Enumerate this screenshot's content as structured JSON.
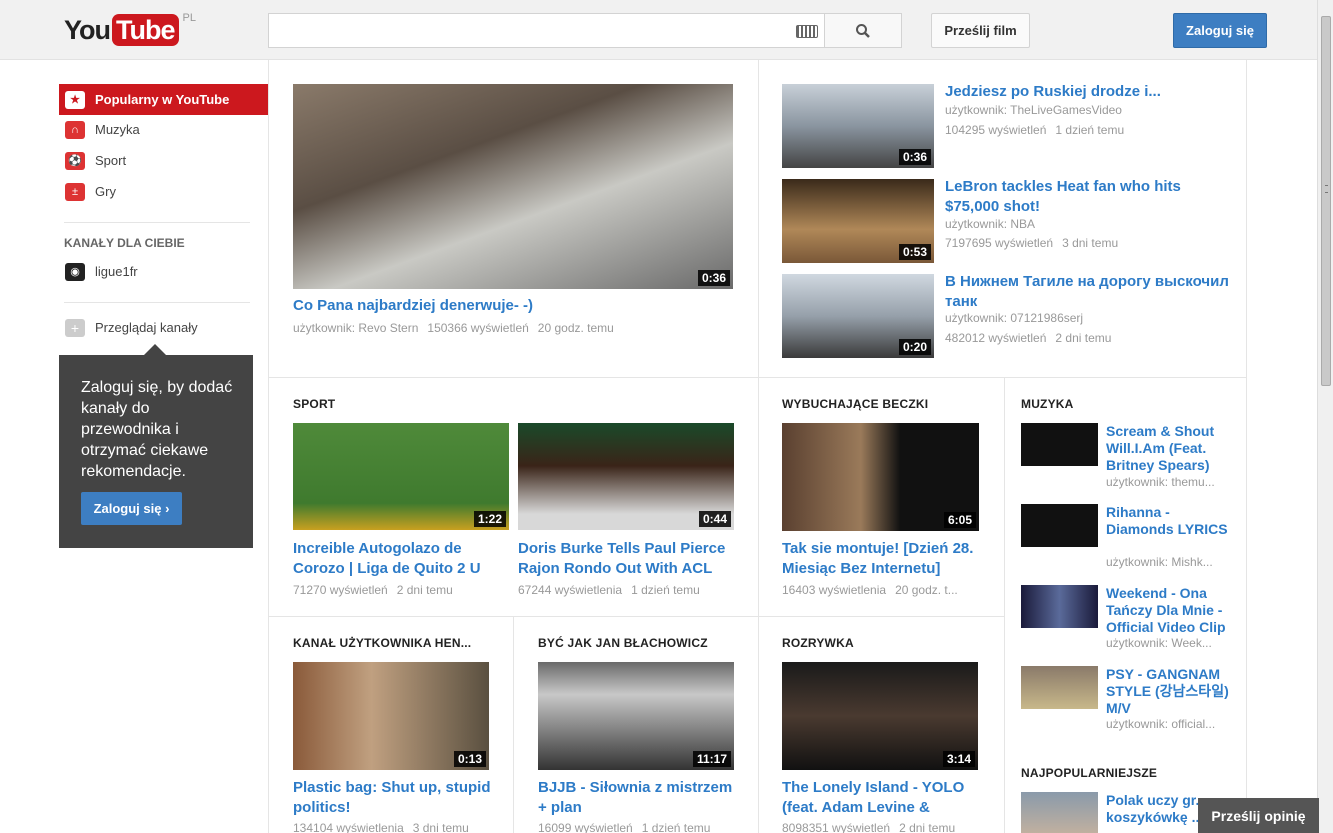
{
  "header": {
    "logo_you": "You",
    "logo_tube": "Tube",
    "logo_region": "PL",
    "search_placeholder": "",
    "upload_label": "Prześlij film",
    "login_label": "Zaloguj się"
  },
  "sidebar": {
    "items": [
      {
        "label": "Popularny w YouTube"
      },
      {
        "label": "Muzyka"
      },
      {
        "label": "Sport"
      },
      {
        "label": "Gry"
      }
    ],
    "channels_heading": "KANAŁY DLA CIEBIE",
    "channel": {
      "label": "ligue1fr"
    },
    "browse_label": "Przeglądaj kanały",
    "tooltip": {
      "text": "Zaloguj się, by dodać kanały do przewodnika i otrzymać ciekawe rekomendacje.",
      "button": "Zaloguj się ›"
    }
  },
  "featured": {
    "title": "Co Pana najbardziej denerwuje- -)",
    "user": "użytkownik: Revo Stern",
    "views": "150366 wyświetleń",
    "age": "20 godz. temu",
    "duration": "0:36"
  },
  "side_videos": [
    {
      "title": "Jedziesz po Ruskiej drodze i...",
      "user": "użytkownik: TheLiveGamesVideo",
      "views": "104295 wyświetleń",
      "age": "1 dzień temu",
      "duration": "0:36"
    },
    {
      "title": "LeBron tackles Heat fan who hits $75,000 shot!",
      "user": "użytkownik: NBA",
      "views": "7197695 wyświetleń",
      "age": "3 dni temu",
      "duration": "0:53"
    },
    {
      "title": "В Нижнем Тагиле на дорогу выскочил танк",
      "user": "użytkownik: 07121986serj",
      "views": "482012 wyświetleń",
      "age": "2 dni temu",
      "duration": "0:20"
    }
  ],
  "sections": {
    "sport": {
      "title": "SPORT",
      "videos": [
        {
          "title": "Increible Autogolazo de Corozo | Liga de Quito 2 U",
          "views": "71270 wyświetleń",
          "age": "2 dni temu",
          "duration": "1:22"
        },
        {
          "title": "Doris Burke Tells Paul Pierce Rajon Rondo Out With ACL",
          "views": "67244 wyświetlenia",
          "age": "1 dzień temu",
          "duration": "0:44"
        }
      ]
    },
    "beczki": {
      "title": "WYBUCHAJĄCE BECZKI",
      "video": {
        "title": "Tak sie montuje! [Dzień 28. Miesiąc Bez Internetu]",
        "views": "16403 wyświetlenia",
        "age": "20 godz. t...",
        "duration": "6:05"
      }
    },
    "kanal": {
      "title": "KANAŁ UŻYTKOWNIKA HEN...",
      "video": {
        "title": "Plastic bag: Shut up, stupid politics!",
        "views": "134104 wyświetlenia",
        "age": "3 dni temu",
        "duration": "0:13"
      }
    },
    "blachowicz": {
      "title": "BYĆ JAK JAN BŁACHOWICZ",
      "video": {
        "title": "BJJB - Siłownia z mistrzem + plan",
        "views": "16099 wyświetleń",
        "age": "1 dzień temu",
        "duration": "11:17"
      }
    },
    "rozrywka": {
      "title": "ROZRYWKA",
      "video": {
        "title": "The Lonely Island - YOLO (feat. Adam Levine &",
        "views": "8098351 wyświetleń",
        "age": "2 dni temu",
        "duration": "3:14"
      }
    }
  },
  "music": {
    "title": "MUZYKA",
    "items": [
      {
        "title": "Scream & Shout Will.I.Am (Feat. Britney Spears)",
        "user": "użytkownik: themu..."
      },
      {
        "title": "Rihanna - Diamonds LYRICS",
        "user": "użytkownik: Mishk..."
      },
      {
        "title": "Weekend - Ona Tańczy Dla Mnie - Official Video Clip",
        "user": "użytkownik: Week..."
      },
      {
        "title": "PSY - GANGNAM STYLE (강남스타일) M/V",
        "user": "użytkownik: official..."
      }
    ]
  },
  "popular": {
    "title": "NAJPOPULARNIEJSZE",
    "item": {
      "title": "Polak uczy gr... koszykówkę ..."
    }
  },
  "feedback_label": "Prześlij opinię"
}
